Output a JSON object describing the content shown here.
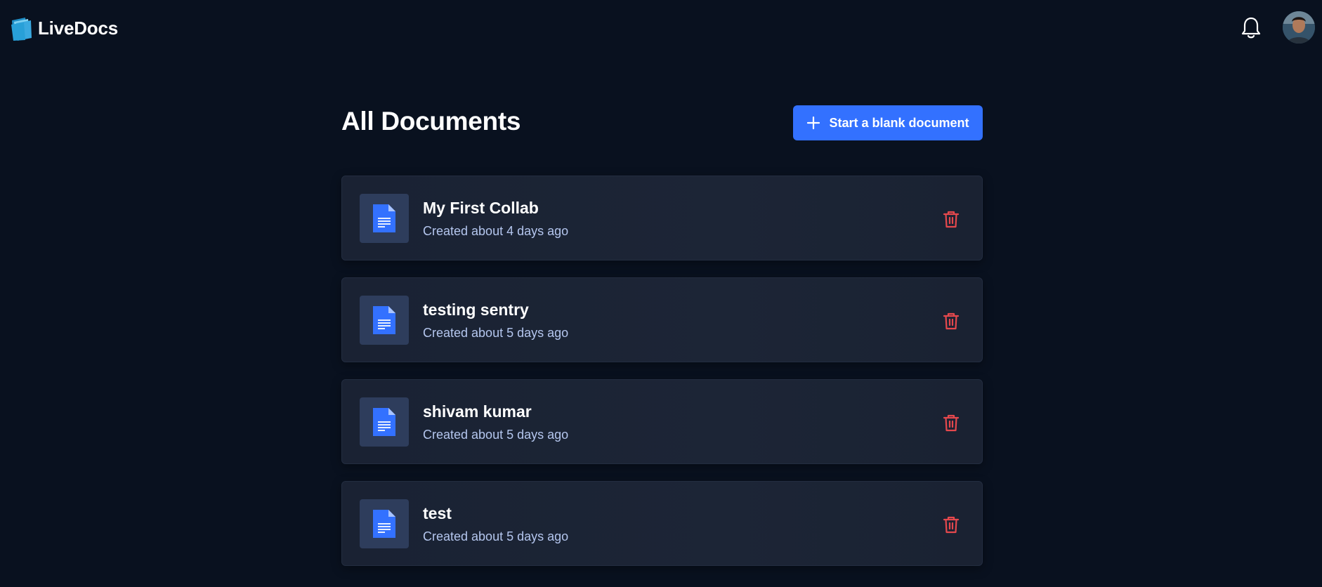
{
  "app": {
    "name": "LiveDocs",
    "logo_icon": "folder-logo-icon"
  },
  "header": {
    "notifications_icon": "bell-icon",
    "user_avatar": "user-avatar"
  },
  "main": {
    "title": "All Documents",
    "new_document_label": "Start a blank document",
    "new_document_icon": "plus-icon"
  },
  "documents": [
    {
      "title": "My First Collab",
      "meta": "Created about 4 days ago"
    },
    {
      "title": "testing sentry",
      "meta": "Created about 5 days ago"
    },
    {
      "title": "shivam kumar",
      "meta": "Created about 5 days ago"
    },
    {
      "title": "test",
      "meta": "Created about 5 days ago"
    }
  ],
  "colors": {
    "background": "#09111f",
    "card": "#1a2233",
    "accent": "#3371ff",
    "delete": "#e5484d",
    "meta_text": "#b4c6ee"
  }
}
